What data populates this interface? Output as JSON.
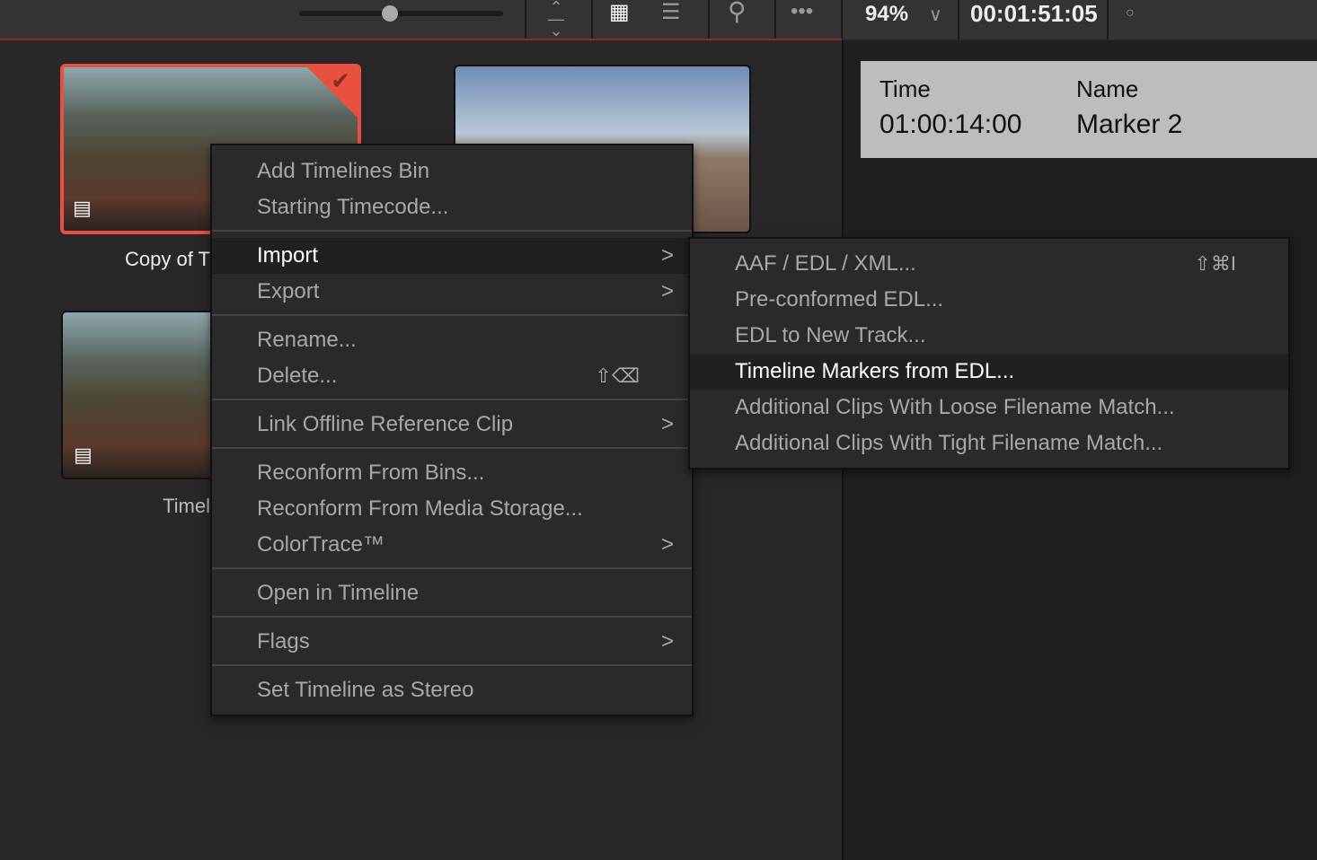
{
  "toolbar": {
    "zoom": "94%",
    "timecode": "00:01:51:05",
    "slider_value": 0.45,
    "icons": [
      "sort-icon",
      "grid-view-icon",
      "list-view-icon",
      "search-icon",
      "more-icon",
      "chevron-down-icon",
      "dot-icon"
    ]
  },
  "viewer": {
    "time_label": "Time",
    "time_value": "01:00:14:00",
    "name_label": "Name",
    "name_value": "Marker 2"
  },
  "bin": {
    "items": [
      {
        "label": "Copy of T",
        "selected": true
      },
      {
        "label": ""
      },
      {
        "label": "Timel"
      }
    ],
    "accent": "#e8503f"
  },
  "context_menu": {
    "items": [
      {
        "label": "Add Timelines Bin"
      },
      {
        "label": "Starting Timecode..."
      },
      {
        "label": "Import",
        "submenu": true,
        "highlighted": true
      },
      {
        "label": "Export",
        "submenu": true
      },
      {
        "label": "Rename..."
      },
      {
        "label": "Delete...",
        "shortcut": "⇧⌫"
      },
      {
        "label": "Link Offline Reference Clip",
        "submenu": true
      },
      {
        "label": "Reconform From Bins..."
      },
      {
        "label": "Reconform From Media Storage..."
      },
      {
        "label": "ColorTrace™",
        "submenu": true
      },
      {
        "label": "Open in Timeline"
      },
      {
        "label": "Flags",
        "submenu": true
      },
      {
        "label": "Set Timeline as Stereo"
      }
    ]
  },
  "import_submenu": {
    "items": [
      {
        "label": "AAF / EDL / XML...",
        "shortcut": "⇧⌘I"
      },
      {
        "label": "Pre-conformed EDL..."
      },
      {
        "label": "EDL to New Track..."
      },
      {
        "label": "Timeline Markers from EDL...",
        "highlighted": true
      },
      {
        "label": "Additional Clips With Loose Filename Match..."
      },
      {
        "label": "Additional Clips With Tight Filename Match..."
      }
    ]
  }
}
